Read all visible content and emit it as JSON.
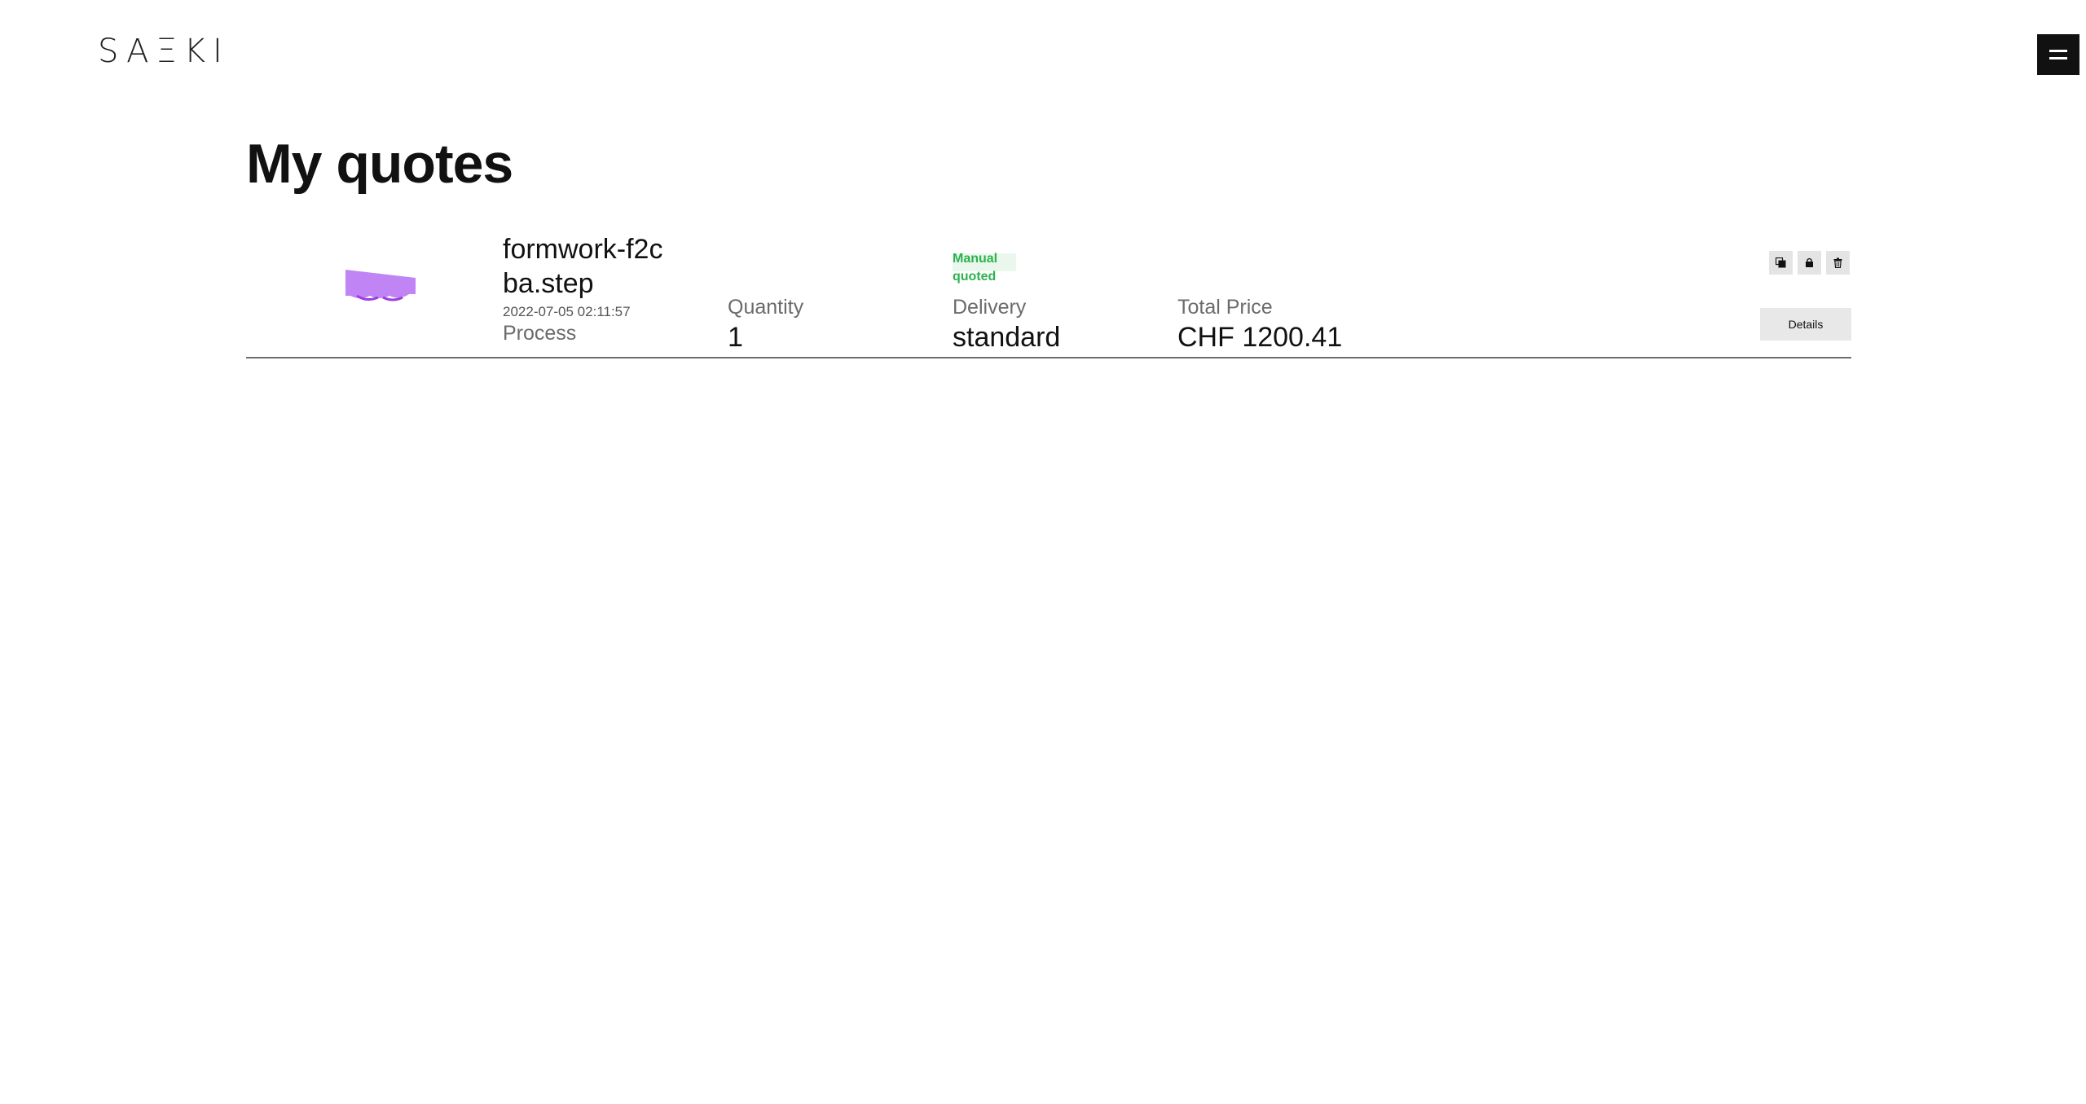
{
  "header": {
    "logo_text": "SAΞKI",
    "menu_icon": "hamburger-menu-icon"
  },
  "page": {
    "title": "My quotes"
  },
  "quotes": [
    {
      "file_name": "formwork-f2cba.step",
      "date": "2022-07-05 02:11:57",
      "process_label": "Process",
      "quantity_label": "Quantity",
      "quantity": "1",
      "delivery_label": "Delivery",
      "delivery": "standard",
      "total_label": "Total Price",
      "total": "CHF 1200.41",
      "status": "Manual quoted",
      "status_color": "#2bb24c",
      "thumbnail_color": "#c084f5",
      "actions": {
        "copy_icon": "copy-icon",
        "cart_icon": "cart-icon",
        "delete_icon": "trash-icon",
        "details_label": "Details"
      }
    }
  ]
}
